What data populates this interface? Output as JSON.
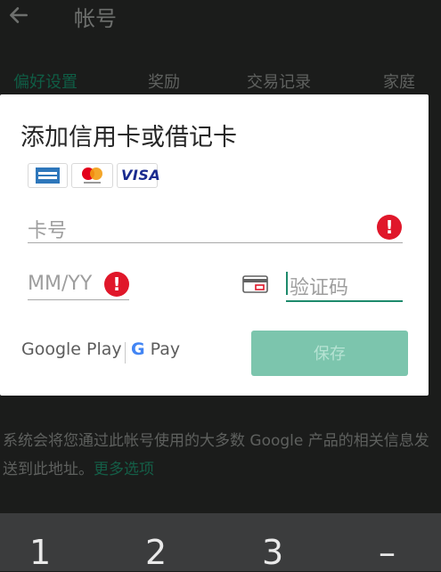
{
  "appbar": {
    "title": "帐号"
  },
  "tabs": [
    "偏好设置",
    "奖励",
    "交易记录",
    "家庭"
  ],
  "dialog": {
    "title": "添加信用卡或借记卡",
    "cards": [
      "amex",
      "mastercard",
      "VISA"
    ],
    "card_number": {
      "placeholder": "卡号"
    },
    "expiry": {
      "placeholder": "MM/YY"
    },
    "cvc": {
      "placeholder": "验证码"
    },
    "error_icon_text": "!",
    "google_play": "Google Play",
    "gpay": {
      "g": "G",
      "pay": "Pay"
    },
    "save_label": "保存"
  },
  "info": {
    "text": "系统会将您通过此帐号使用的大多数 Google 产品的相关信息发送到此地址。",
    "link": "更多选项"
  },
  "keypad": [
    "1",
    "2",
    "3",
    "–"
  ],
  "colors": {
    "accent": "#1e8a6c",
    "error": "#e0172a",
    "save_disabled": "#7cc5ad"
  }
}
